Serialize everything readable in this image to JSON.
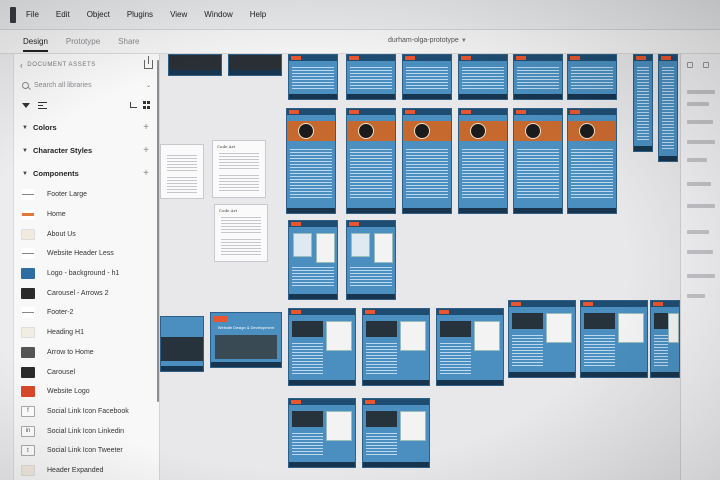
{
  "menu": [
    "File",
    "Edit",
    "Object",
    "Plugins",
    "View",
    "Window",
    "Help"
  ],
  "modes": {
    "design": "Design",
    "prototype": "Prototype",
    "share": "Share"
  },
  "document": {
    "title": "durham-olga-prototype"
  },
  "assets": {
    "header": "DOCUMENT ASSETS",
    "search_placeholder": "Search all libraries",
    "sections": {
      "colors": "Colors",
      "character_styles": "Character Styles",
      "components": "Components"
    },
    "components": [
      {
        "label": "Footer Large",
        "thumb": "th-line"
      },
      {
        "label": "Home",
        "thumb": "th-bar"
      },
      {
        "label": "About Us",
        "thumb": "th-pale"
      },
      {
        "label": "Website Header Less",
        "thumb": "th-line"
      },
      {
        "label": "Logo - background - h1",
        "thumb": "th-blue"
      },
      {
        "label": "Carousel - Arrows 2",
        "thumb": "th-dark"
      },
      {
        "label": "Footer-2",
        "thumb": "th-line"
      },
      {
        "label": "Heading H1",
        "thumb": "th-h1"
      },
      {
        "label": "Arrow to Home",
        "thumb": "th-darkg"
      },
      {
        "label": "Carousel",
        "thumb": "th-dark"
      },
      {
        "label": "Website Logo",
        "thumb": "th-logo"
      },
      {
        "label": "Social Link Icon Facebook",
        "thumb": "th-ic",
        "glyph": "f"
      },
      {
        "label": "Social Link Icon Linkedin",
        "thumb": "th-ic",
        "glyph": "in"
      },
      {
        "label": "Social Link Icon Tweeter",
        "thumb": "th-ic",
        "glyph": "t"
      },
      {
        "label": "Header Expanded",
        "thumb": "th-pale"
      }
    ]
  },
  "canvas": {
    "wire_title": "Code Art",
    "hero_title": "Website Design & Development"
  },
  "colors": {
    "artboard_blue": "#4a8fc0",
    "header_navy": "#1f4d72",
    "accent_orange": "#c6692f",
    "logo_red": "#e8552e"
  }
}
